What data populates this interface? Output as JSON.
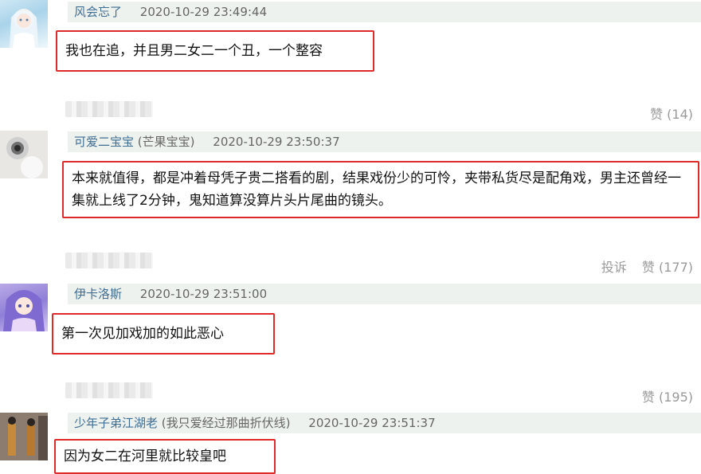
{
  "comments": [
    {
      "user": "风会忘了",
      "nickname": "",
      "time": "2020-10-29 23:49:44",
      "text": "我也在追，并且男二女二一个丑，一个整容",
      "avatar": "anime-girl-white-icon",
      "actions": {
        "report": "",
        "like": "赞 (14)"
      }
    },
    {
      "user": "可爱二宝宝",
      "nickname": "(芒果宝宝)",
      "time": "2020-10-29 23:50:37",
      "text": "本来就值得，都是冲着母凭子贵二搭看的剧，结果戏份少的可怜，夹带私货尽是配角戏，男主还曾经一集就上线了2分钟，鬼知道算没算片头片尾曲的镜头。",
      "avatar": "camera-toy-icon",
      "actions": {
        "report": "投诉",
        "like": "赞 (177)"
      }
    },
    {
      "user": "伊卡洛斯",
      "nickname": "",
      "time": "2020-10-29 23:51:00",
      "text": "第一次见加戏加的如此恶心",
      "avatar": "anime-girl-purple-icon",
      "actions": {
        "report": "",
        "like": "赞 (195)"
      }
    },
    {
      "user": "少年子弟江湖老",
      "nickname": "(我只爱经过那曲折伏线)",
      "time": "2020-10-29 23:51:37",
      "text": "因为女二在河里就比较皇吧",
      "avatar": "street-photo-icon",
      "actions": {
        "report": "",
        "like": ""
      }
    }
  ]
}
